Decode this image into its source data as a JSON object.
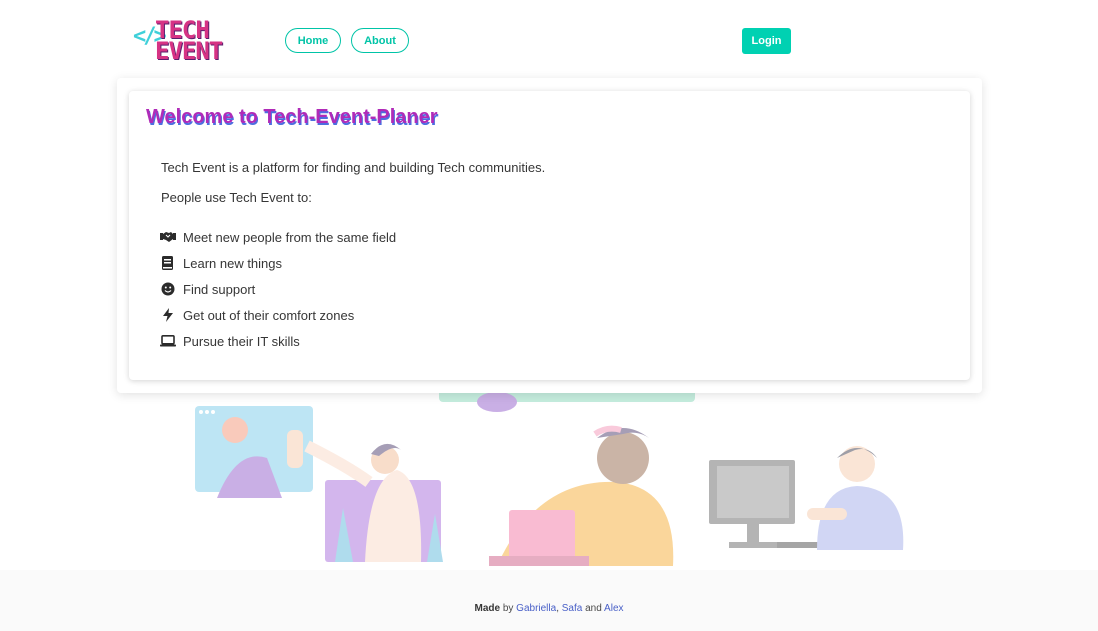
{
  "navbar": {
    "logo_text_line1": "TECH",
    "logo_text_line2": "EVENT",
    "logo_bracket": "</>",
    "home_label": "Home",
    "about_label": "About",
    "login_label": "Login"
  },
  "card": {
    "title": "Welcome to Tech-Event-Planer",
    "intro": "Tech Event is a platform for finding and building Tech communities.",
    "people_use": "People use Tech Event to:",
    "features": [
      {
        "icon": "handshake-icon",
        "label": "Meet new people from the same field"
      },
      {
        "icon": "book-icon",
        "label": "Learn new things"
      },
      {
        "icon": "smile-icon",
        "label": "Find support"
      },
      {
        "icon": "bolt-icon",
        "label": "Get out of their comfort zones"
      },
      {
        "icon": "laptop-icon",
        "label": "Pursue their IT skills"
      }
    ]
  },
  "footer": {
    "made": "Made",
    "by": " by ",
    "author1": "Gabriella",
    "sep1": ", ",
    "author2": "Safa",
    "and": " and ",
    "author3": "Alex"
  },
  "colors": {
    "accent": "#00d1b2",
    "title": "#b02bb8",
    "title_shadow": "#4d6ee0",
    "link": "#485fc7",
    "logo": "#d63384"
  }
}
